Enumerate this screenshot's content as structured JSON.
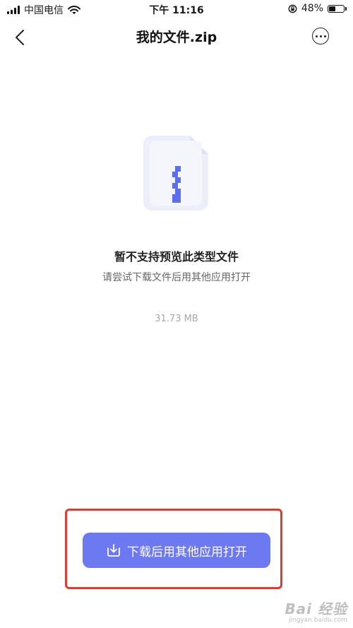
{
  "status_bar": {
    "carrier": "中国电信",
    "time": "下午 11:16",
    "battery_percent_text": "48%",
    "battery_level": 0.48
  },
  "navbar": {
    "title": "我的文件.zip",
    "back_icon": "chevron-left-icon",
    "more_icon": "more-horizontal-icon"
  },
  "content": {
    "file_icon": "zip-file-icon",
    "message_title": "暂不支持预览此类型文件",
    "message_subtitle": "请尝试下载文件后用其他应用打开",
    "file_size": "31.73 MB"
  },
  "action": {
    "download_label": "下载后用其他应用打开",
    "download_icon": "download-icon"
  },
  "watermark": {
    "brand": "Bai 经验",
    "url": "jingyan.baidu.com"
  },
  "colors": {
    "accent": "#6d79f1",
    "highlight_border": "#e23a2e",
    "zip_stripe": "#5b6ef0",
    "file_icon_bg": "#eceef9"
  }
}
